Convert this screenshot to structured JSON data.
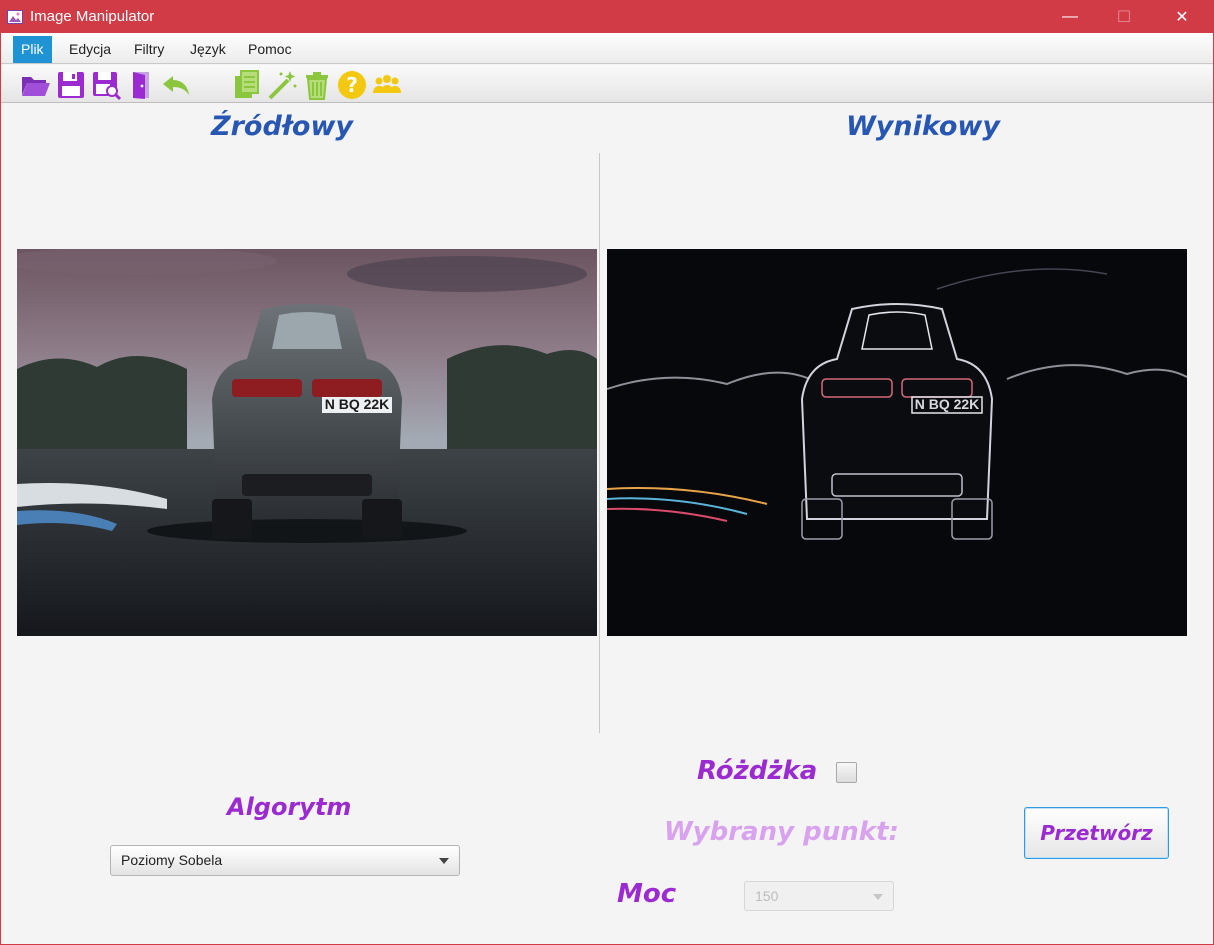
{
  "window": {
    "title": "Image Manipulator",
    "controls": {
      "minimize": "—",
      "maximize": "☐",
      "close": "✕"
    }
  },
  "menu": {
    "items": [
      {
        "label": "Plik",
        "active": true
      },
      {
        "label": "Edycja",
        "active": false
      },
      {
        "label": "Filtry",
        "active": false
      },
      {
        "label": "Język",
        "active": false
      },
      {
        "label": "Pomoc",
        "active": false
      }
    ]
  },
  "toolbar": {
    "icons": [
      "open-folder-icon",
      "save-icon",
      "save-as-icon",
      "exit-door-icon",
      "undo-icon",
      "copy-icon",
      "magic-wand-icon",
      "trash-icon",
      "help-icon",
      "authors-icon"
    ]
  },
  "panes": {
    "source_title": "Źródłowy",
    "result_title": "Wynikowy",
    "source_plate": "N BQ 22K",
    "result_plate": "N BQ 22K"
  },
  "controls": {
    "algorithm_label": "Algorytm",
    "algorithm_value": "Poziomy Sobela",
    "wand_label": "Różdżka",
    "wand_checked": false,
    "selected_point_label": "Wybrany punkt:",
    "power_label": "Moc",
    "power_value": "150",
    "process_button": "Przetwórz"
  },
  "colors": {
    "titlebar": "#d13b45",
    "heading_blue": "#2757b3",
    "label_purple": "#9b2bd0",
    "menu_active": "#1f93d3"
  }
}
